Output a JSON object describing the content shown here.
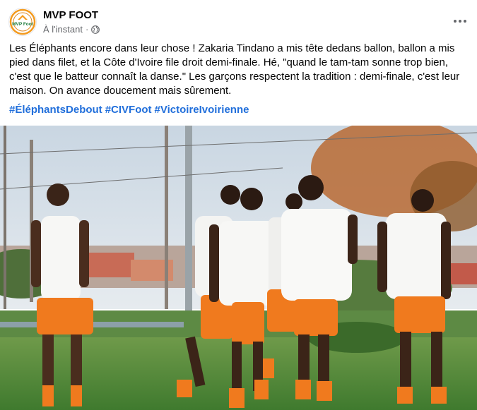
{
  "post": {
    "page_name": "MVP FOOT",
    "avatar_text": "MVP Foot",
    "timestamp": "À l'instant",
    "separator": "·",
    "audience_icon": "globe-icon",
    "more_icon": "more-horizontal-icon",
    "body": "Les Éléphants encore dans leur chose ! Zakaria Tindano a mis tête dedans ballon, ballon a mis pied dans filet, et la Côte d'Ivoire file droit demi-finale. Hé, \"quand le tam-tam sonne trop bien, c'est que le batteur connaît la danse.\" Les garçons respectent la tradition : demi-finale, c'est leur maison. On avance doucement mais sûrement.",
    "hashtags": [
      "#ÉléphantsDebout",
      "#CIVFoot",
      "#VictoireIvoirienne"
    ]
  },
  "photo": {
    "description_icon": "team-training-photo"
  },
  "colors": {
    "text": "#050505",
    "secondary": "#65676b",
    "link": "#216fdb",
    "jersey": "#f7f7f5",
    "shorts": "#f07a1e",
    "grass": "#4f8a3a",
    "sky": "#dfe6ec"
  }
}
